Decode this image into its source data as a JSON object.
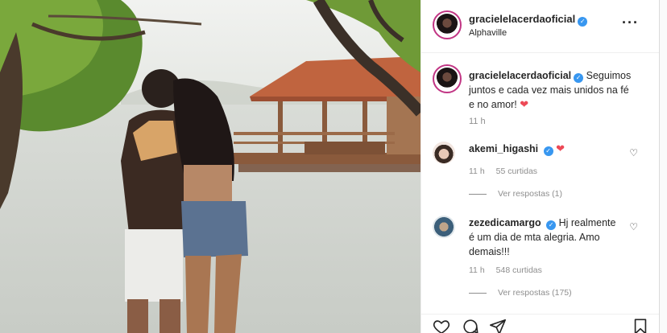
{
  "post": {
    "username": "gracielelacerdaoficial",
    "location": "Alphaville",
    "caption_text": "Seguimos juntos e cada vez mais unidos na fé e no amor!",
    "caption_emoji": "❤",
    "caption_time": "11 h"
  },
  "comments": [
    {
      "username": "akemi_higashi",
      "text": "",
      "emoji": "❤",
      "time": "11 h",
      "likes": "55 curtidas",
      "replies": "Ver respostas (1)"
    },
    {
      "username": "zezedicamargo",
      "text": "Hj realmente é um dia de mta alegria. Amo demais!!!",
      "emoji": "",
      "time": "11 h",
      "likes": "548 curtidas",
      "replies": "Ver respostas (175)"
    }
  ],
  "icons": {
    "more": "more-options-icon",
    "verified": "verified-badge-icon",
    "like": "heart-outline-icon",
    "comment": "comment-icon",
    "share": "paper-plane-icon",
    "save": "bookmark-icon"
  },
  "colors": {
    "verified": "#3897f0",
    "heart": "#ed4956",
    "muted": "#8e8e8e",
    "story_ring": "#c13584"
  }
}
